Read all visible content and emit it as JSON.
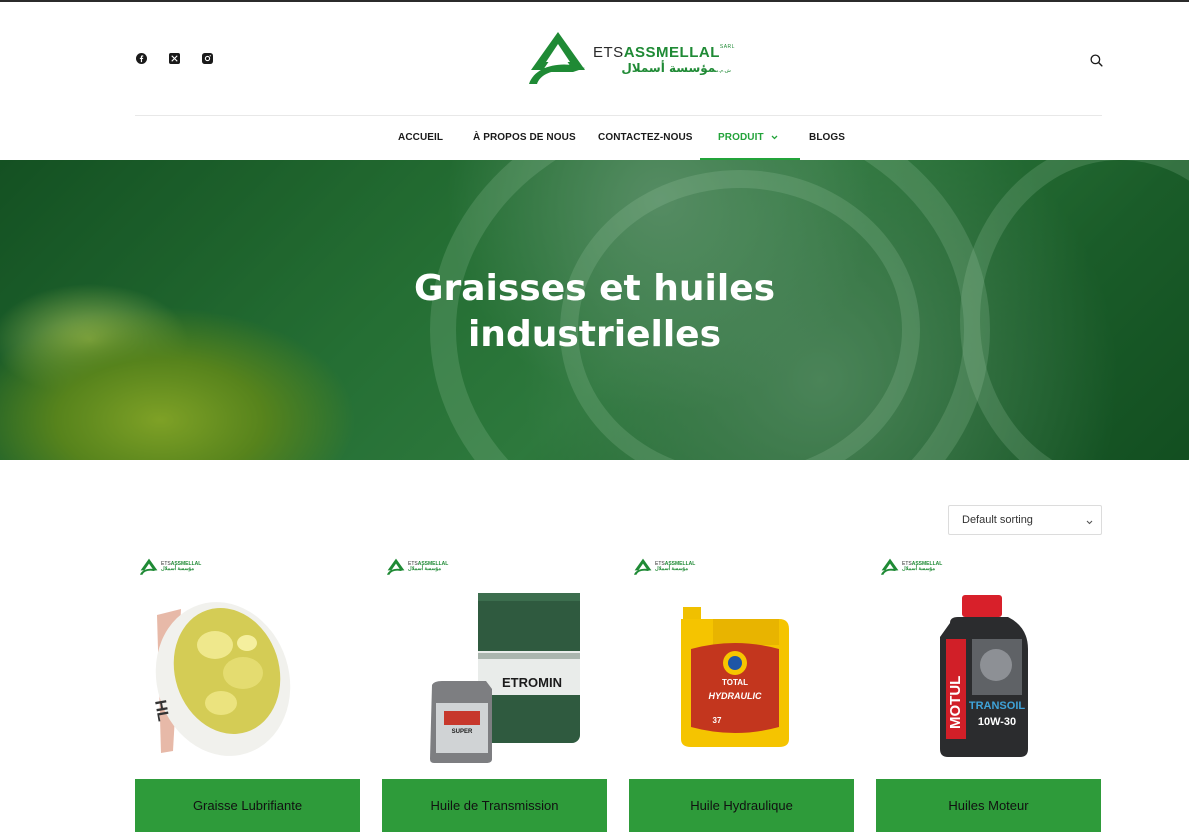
{
  "brand": {
    "latin_prefix": "ETS",
    "latin_name": "ASSMELLAL",
    "latin_suffix": "SARL",
    "arabic_name": "مؤسسة أسملال",
    "arabic_suffix": "ش.م.م",
    "colors": {
      "primary": "#23a33a",
      "dark_green": "#1f8a35",
      "button": "#2e9b3a"
    }
  },
  "socials": [
    {
      "icon": "facebook-icon"
    },
    {
      "icon": "x-twitter-icon"
    },
    {
      "icon": "instagram-icon"
    }
  ],
  "header": {
    "search_icon": "search-icon"
  },
  "nav": {
    "items": [
      {
        "label": "ACCUEIL"
      },
      {
        "label": "À PROPOS DE NOUS"
      },
      {
        "label": "CONTACTEZ-NOUS"
      },
      {
        "label": "PRODUIT",
        "active": true,
        "has_dropdown": true
      },
      {
        "label": "BLOGS"
      }
    ]
  },
  "hero": {
    "title_line1": "Graisses et huiles",
    "title_line2": "industrielles"
  },
  "sorting": {
    "selected": "Default sorting"
  },
  "products": [
    {
      "name": "Graisse Lubrifiante",
      "image": "grease-tub"
    },
    {
      "name": "Huile de Transmission",
      "image": "petromin-drum-and-can"
    },
    {
      "name": "Huile Hydraulique",
      "image": "total-hydraulic-can",
      "brand_label": "TOTAL",
      "product_label": "HYDRAULIC",
      "grade": "37"
    },
    {
      "name": "Huiles Moteur",
      "image": "motul-transoil-bottle",
      "brand_label": "MOTUL",
      "product_label": "TRANSOIL",
      "grade": "10W-30"
    }
  ]
}
